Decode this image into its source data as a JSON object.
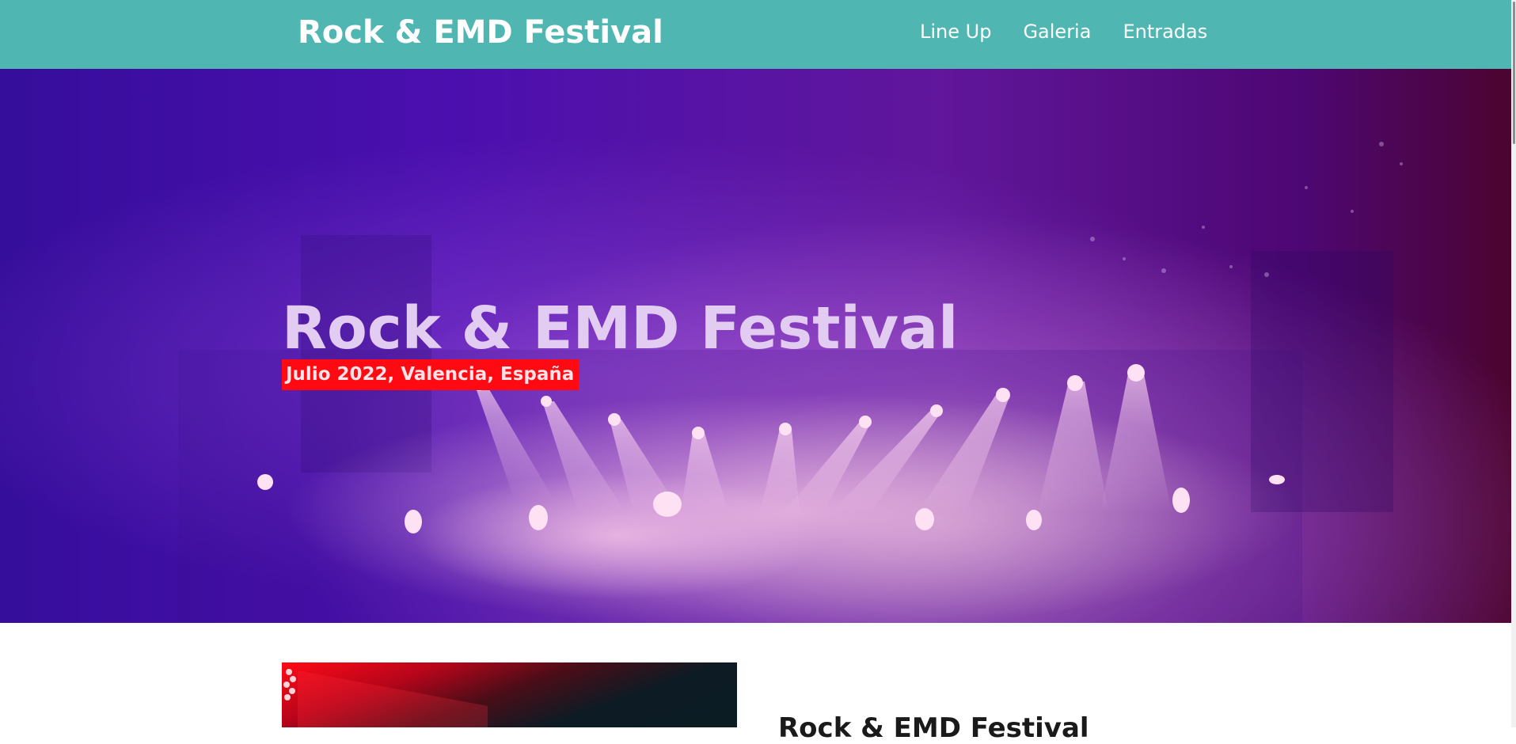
{
  "nav": {
    "brand": "Rock & EMD Festival",
    "links": [
      "Line Up",
      "Galeria",
      "Entradas"
    ]
  },
  "hero": {
    "title": "Rock & EMD Festival",
    "subtitle": "Julio 2022, Valencia, España"
  },
  "intro": {
    "heading": "Rock & EMD Festival"
  },
  "colors": {
    "nav_bg": "#4fb6b1",
    "subtitle_bg": "#ff0a12",
    "hero_gradient": [
      "#3a10a8",
      "#6b1aa8",
      "#54052c"
    ]
  }
}
